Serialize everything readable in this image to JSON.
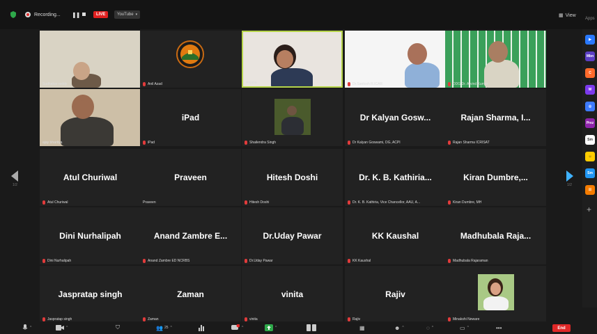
{
  "top_bar": {
    "recording_label": "Recording...",
    "pause_icon_text": "❚❚",
    "live_badge": "LIVE",
    "youtube_label": "YouTube",
    "view_label": "View",
    "apps_label": "Apps"
  },
  "navigation": {
    "page_left": "1/2",
    "page_right": "1/2"
  },
  "tiles": [
    {
      "label": "Sudhakar reddy",
      "big": "",
      "muted": false
    },
    {
      "label": "Anil Azad",
      "big": "",
      "muted": true
    },
    {
      "label": "Anjana",
      "big": "",
      "muted": false
    },
    {
      "label": "Dr.Santosh R.ICAR",
      "big": "",
      "muted": true
    },
    {
      "label": "DDG Dr. Arvind Kumar",
      "big": "",
      "muted": true
    },
    {
      "label": "ajay bhartiya",
      "big": "",
      "muted": false
    },
    {
      "label": "iPad",
      "big": "iPad",
      "muted": true
    },
    {
      "label": "Shailendra Singh",
      "big": "",
      "muted": true
    },
    {
      "label": "Dr Kalyan Goswami, DG, ACPI",
      "big": "Dr Kalyan Gosw...",
      "muted": true
    },
    {
      "label": "Rajan Sharma ICRISAT",
      "big": "Rajan Sharma, I...",
      "muted": true
    },
    {
      "label": "Atul Churiwal",
      "big": "Atul Churiwal",
      "muted": true
    },
    {
      "label": "Praveen",
      "big": "Praveen",
      "muted": false
    },
    {
      "label": "Hitesh Doshi",
      "big": "Hitesh Doshi",
      "muted": true
    },
    {
      "label": "Dr. K. B. Kathiria, Vice Chancellor, AAU, A...",
      "big": "Dr. K. B. Kathiria...",
      "muted": true
    },
    {
      "label": "Kiran Dumbre, MH",
      "big": "Kiran Dumbre,...",
      "muted": true
    },
    {
      "label": "Dini Nurhalipah",
      "big": "Dini Nurhalipah",
      "muted": true
    },
    {
      "label": "Anand Zambre ED NCRBS",
      "big": "Anand Zambre E...",
      "muted": true
    },
    {
      "label": "Dr.Uday Pawar",
      "big": "Dr.Uday Pawar",
      "muted": true
    },
    {
      "label": "KK Kaushal",
      "big": "KK Kaushal",
      "muted": true
    },
    {
      "label": "Madhubala Rajaraman",
      "big": "Madhubala Raja...",
      "muted": true
    },
    {
      "label": "Jaspratap singh",
      "big": "Jaspratap singh",
      "muted": true
    },
    {
      "label": "Zaman",
      "big": "Zaman",
      "muted": true
    },
    {
      "label": "vinita",
      "big": "vinita",
      "muted": true
    },
    {
      "label": "Rajiv",
      "big": "Rajiv",
      "muted": true
    },
    {
      "label": "Minakshi Neware",
      "big": "",
      "muted": true
    }
  ],
  "apps": [
    {
      "short": "▶",
      "color": "#2979ff"
    },
    {
      "short": "Mbn",
      "color": "#5b3fc4"
    },
    {
      "short": "C",
      "color": "#ff6a2b"
    },
    {
      "short": "W",
      "color": "#7c3aed"
    },
    {
      "short": "◎",
      "color": "#3d7bff"
    },
    {
      "short": "Prez",
      "color": "#8e24aa"
    },
    {
      "short": "Sm",
      "color": "#ffffff"
    },
    {
      "short": "☺",
      "color": "#ffcc00"
    },
    {
      "short": "Sm",
      "color": "#2196f3"
    },
    {
      "short": "☷",
      "color": "#f57c00"
    }
  ],
  "toolbar": {
    "participants_count": "25",
    "end_label": "End"
  }
}
